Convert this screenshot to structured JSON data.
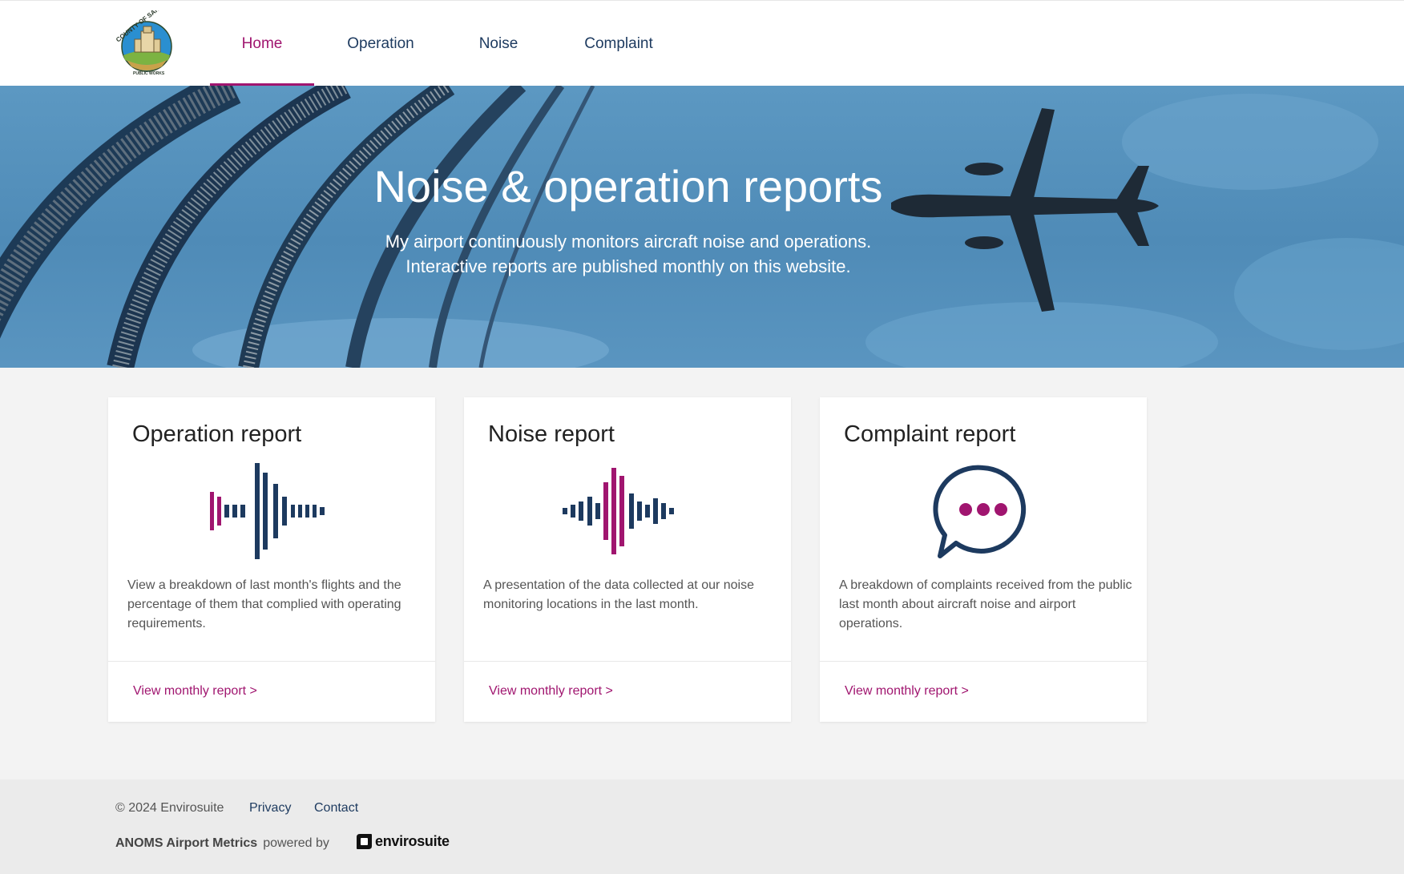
{
  "header": {
    "logo_text": "COUNTY OF SAN DIEGO",
    "logo_subtext": "PUBLIC WORKS",
    "nav": [
      {
        "label": "Home",
        "active": true
      },
      {
        "label": "Operation",
        "active": false
      },
      {
        "label": "Noise",
        "active": false
      },
      {
        "label": "Complaint",
        "active": false
      }
    ]
  },
  "hero": {
    "title": "Noise & operation reports",
    "subtitle_line1": "My airport continuously monitors aircraft noise and operations.",
    "subtitle_line2": "Interactive reports are published monthly on this website."
  },
  "cards": [
    {
      "title": "Operation report",
      "icon": "waveform-operation-icon",
      "description": "View a breakdown of last month's flights and the percentage of them that complied with operating requirements.",
      "link": "View monthly report >"
    },
    {
      "title": "Noise report",
      "icon": "waveform-noise-icon",
      "description": "A presentation of the data collected at our noise monitoring locations in the last month.",
      "link": "View monthly report >"
    },
    {
      "title": "Complaint report",
      "icon": "speech-bubble-icon",
      "description": "A breakdown of complaints received from the public last month about aircraft noise and airport operations.",
      "link": "View monthly report >"
    }
  ],
  "footer": {
    "copyright": "© 2024 Envirosuite",
    "links": [
      "Privacy",
      "Contact"
    ],
    "product_name": "ANOMS Airport Metrics",
    "powered_by": "powered by",
    "brand": "envirosuite"
  },
  "colors": {
    "accent": "#a0156f",
    "navy": "#1d3a5f",
    "hero_blue": "#5a95c0"
  }
}
